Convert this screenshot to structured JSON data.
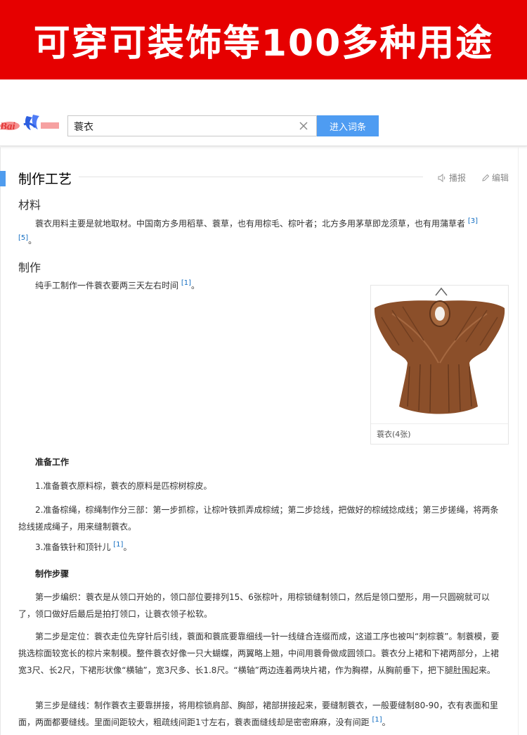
{
  "banner": {
    "text": "可穿可装饰等100多种用途"
  },
  "search": {
    "value": "蓑衣",
    "button_label": "进入词条"
  },
  "section": {
    "title": "制作工艺",
    "actions": {
      "report": "播报",
      "edit": "编辑"
    }
  },
  "material": {
    "heading": "材料",
    "text": "蓑衣用料主要是就地取材。中国南方多用稻草、蓑草，也有用棕毛、棕叶者；北方多用茅草即龙须草，也有用蒲草者",
    "ref1": "[3]",
    "ref2": "[5]",
    "end": "。"
  },
  "make": {
    "heading": "制作",
    "text": "纯手工制作一件蓑衣要两三天左右时间",
    "ref": "[1]",
    "end": "。"
  },
  "image": {
    "caption": "蓑衣(4张)"
  },
  "prep": {
    "title": "准备工作",
    "item1": "1.准备蓑衣原料棕，蓑衣的原料是匹棕树棕皮。",
    "item2": "2.准备棕绳，棕绳制作分三部：第一步抓棕，让棕叶铁抓弄成棕绒；第二步捻线，把做好的棕绒捻成线；第三步搓绳，将两条捻线搓成绳子，用来缝制蓑衣。",
    "item3": "3.准备铁针和顶针儿",
    "item3_ref": "[1]",
    "item3_end": "。"
  },
  "steps": {
    "title": "制作步骤",
    "step1": "第一步编织：蓑衣是从领口开始的，领口部位要排列15、6张棕叶，用棕锁缝制领口，然后是领口塑形，用一只圆碗就可以了，领口做好后最后是拍打领口，让蓑衣领子松软。",
    "step2": "第二步是定位：蓑衣走位先穿针后引线，蓑面和蓑底要靠细线一针一线缝合连缀而成，这道工序也被叫“刺棕蓑”。制蓑模，要挑选棕面较宽长的棕片来制模。整件蓑衣好像一只大蝴蝶，两翼略上翘，中间用蓑骨做成圆领口。蓑衣分上裙和下裙两部分，上裙宽3尺、长2尺，下裙形状像“横轴”，宽3尺多、长1.8尺。“横轴”两边连着两块片裙，作为胸襟，从胸前垂下，把下腿肚围起来。",
    "step3": "第三步是缝线：制作蓑衣主要靠拼接，将用棕锁肩部、胸部，裙部拼接起来，要缝制蓑衣，一般要缝制80-90，衣有表面和里面，两面都要缝线。里面间距较大，粗疏线间距1寸左右，蓑表面缝线却是密密麻麻，没有间距",
    "step3_ref": "[1]",
    "step3_end": "。"
  }
}
